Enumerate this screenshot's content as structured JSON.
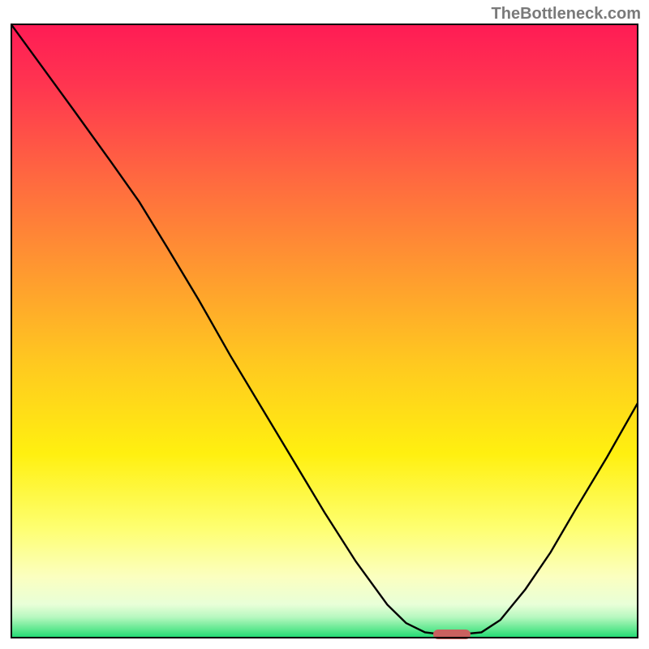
{
  "watermark": "TheBottleneck.com",
  "chart_data": {
    "type": "line",
    "title": "",
    "xlabel": "",
    "ylabel": "",
    "x_range": [
      0,
      100
    ],
    "y_range": [
      0,
      100
    ],
    "gradient_stops": [
      {
        "pos": 0.0,
        "color": "#ff1b55"
      },
      {
        "pos": 0.1,
        "color": "#ff3550"
      },
      {
        "pos": 0.25,
        "color": "#ff6840"
      },
      {
        "pos": 0.4,
        "color": "#ff9830"
      },
      {
        "pos": 0.55,
        "color": "#ffc820"
      },
      {
        "pos": 0.7,
        "color": "#fff010"
      },
      {
        "pos": 0.82,
        "color": "#feff70"
      },
      {
        "pos": 0.9,
        "color": "#fbffc0"
      },
      {
        "pos": 0.945,
        "color": "#e8ffd8"
      },
      {
        "pos": 0.965,
        "color": "#b8f8c0"
      },
      {
        "pos": 0.985,
        "color": "#60e890"
      },
      {
        "pos": 1.0,
        "color": "#18d870"
      }
    ],
    "curve_points": [
      {
        "x": 0.0,
        "y": 100.0
      },
      {
        "x": 5.0,
        "y": 93.0
      },
      {
        "x": 10.0,
        "y": 86.0
      },
      {
        "x": 16.0,
        "y": 77.5
      },
      {
        "x": 20.5,
        "y": 71.0
      },
      {
        "x": 25.0,
        "y": 63.5
      },
      {
        "x": 30.0,
        "y": 55.0
      },
      {
        "x": 35.0,
        "y": 46.0
      },
      {
        "x": 40.0,
        "y": 37.5
      },
      {
        "x": 45.0,
        "y": 29.0
      },
      {
        "x": 50.0,
        "y": 20.5
      },
      {
        "x": 55.0,
        "y": 12.5
      },
      {
        "x": 60.0,
        "y": 5.5
      },
      {
        "x": 63.0,
        "y": 2.5
      },
      {
        "x": 66.0,
        "y": 1.0
      },
      {
        "x": 70.0,
        "y": 0.5
      },
      {
        "x": 75.0,
        "y": 1.0
      },
      {
        "x": 78.0,
        "y": 3.0
      },
      {
        "x": 82.0,
        "y": 8.0
      },
      {
        "x": 86.0,
        "y": 14.0
      },
      {
        "x": 90.0,
        "y": 21.0
      },
      {
        "x": 95.0,
        "y": 29.5
      },
      {
        "x": 100.0,
        "y": 38.5
      }
    ],
    "marker": {
      "x_center": 70.3,
      "y_center": 0.7,
      "width_pct": 6.0,
      "height_pct": 1.6,
      "color": "#c9615f"
    }
  }
}
